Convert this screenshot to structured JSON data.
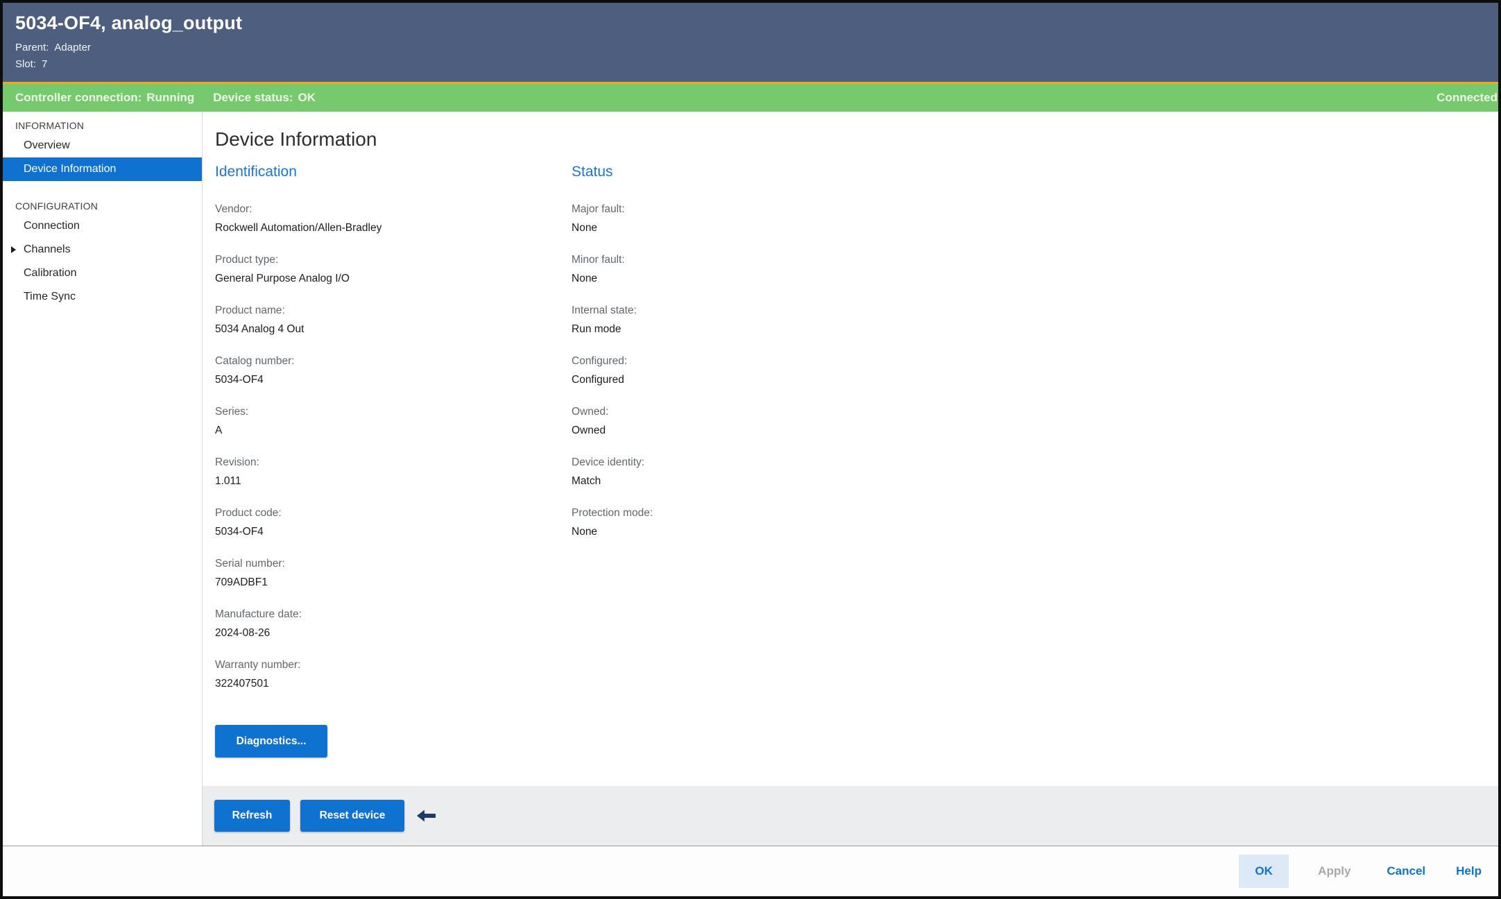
{
  "window": {
    "title": "5034-OF4, analog_output",
    "parent_label": "Parent:",
    "parent_value": "Adapter",
    "slot_label": "Slot:",
    "slot_value": "7"
  },
  "status_bar": {
    "controller_connection_label": "Controller connection:",
    "controller_connection_value": "Running",
    "device_status_label": "Device status:",
    "device_status_value": "OK",
    "connection_state": "Connected"
  },
  "sidebar": {
    "sections": [
      {
        "heading": "INFORMATION",
        "items": [
          {
            "label": "Overview",
            "selected": false
          },
          {
            "label": "Device Information",
            "selected": true
          }
        ]
      },
      {
        "heading": "CONFIGURATION",
        "items": [
          {
            "label": "Connection",
            "selected": false
          },
          {
            "label": "Channels",
            "selected": false,
            "expandable": true
          },
          {
            "label": "Calibration",
            "selected": false
          },
          {
            "label": "Time Sync",
            "selected": false
          }
        ]
      }
    ]
  },
  "main": {
    "title": "Device Information",
    "identification": {
      "heading": "Identification",
      "fields": [
        {
          "label": "Vendor:",
          "value": "Rockwell Automation/Allen-Bradley"
        },
        {
          "label": "Product type:",
          "value": "General Purpose Analog I/O"
        },
        {
          "label": "Product name:",
          "value": "5034 Analog 4 Out"
        },
        {
          "label": "Catalog number:",
          "value": "5034-OF4"
        },
        {
          "label": "Series:",
          "value": "A"
        },
        {
          "label": "Revision:",
          "value": "1.011"
        },
        {
          "label": "Product code:",
          "value": "5034-OF4"
        },
        {
          "label": "Serial number:",
          "value": "709ADBF1"
        },
        {
          "label": "Manufacture date:",
          "value": "2024-08-26"
        },
        {
          "label": "Warranty number:",
          "value": "322407501"
        }
      ]
    },
    "status": {
      "heading": "Status",
      "fields": [
        {
          "label": "Major fault:",
          "value": "None"
        },
        {
          "label": "Minor fault:",
          "value": "None"
        },
        {
          "label": "Internal state:",
          "value": "Run mode"
        },
        {
          "label": "Configured:",
          "value": "Configured"
        },
        {
          "label": "Owned:",
          "value": "Owned"
        },
        {
          "label": "Device identity:",
          "value": "Match"
        },
        {
          "label": "Protection mode:",
          "value": "None"
        }
      ]
    },
    "diagnostics_label": "Diagnostics...",
    "action_bar": {
      "refresh_label": "Refresh",
      "reset_label": "Reset device"
    }
  },
  "footer": {
    "ok_label": "OK",
    "apply_label": "Apply",
    "cancel_label": "Cancel",
    "help_label": "Help"
  },
  "colors": {
    "accent_blue": "#0f72d0",
    "status_green": "#76c96c",
    "header_navy": "#4d5e7e",
    "accent_yellow": "#e9ad1c",
    "ok_highlight": "#dde9f6"
  }
}
